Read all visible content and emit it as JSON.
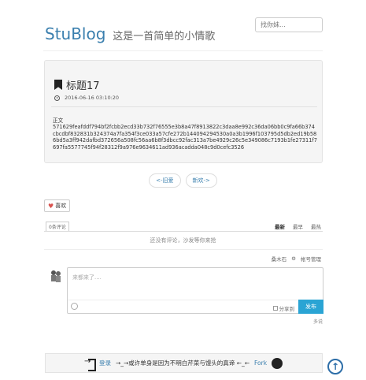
{
  "site": {
    "brand": "StuBlog",
    "tagline": "这是一首简单的小情歌"
  },
  "search": {
    "placeholder": "找你妹..."
  },
  "post": {
    "title": "标题17",
    "date": "2016-06-16 03:10:20",
    "body": "正文\n571629feafddf794bf2fcbb2ecd33b732f76555e3b8a47f8913822c3daa8e992c36da06bb0c9fa66b374cbcdbf832831b324374a7fa354f3ce033a57cfe272b144094294530a0a3b1996f103795d5db2ed19b586bd5a3ff942dafbd372656a508fc56aa6b8f3dbcc92fac313a7be4929c26c5e349086c7193b1fe27311f7697fa5577745f94f28312f9a976e9634611ad936acadda048c9d0cefc3526"
  },
  "pager": {
    "prev": "<-旧爱",
    "next": "新欢->"
  },
  "like": {
    "label": "喜欢"
  },
  "comments": {
    "count_label": "0条评论",
    "sort": [
      "最新",
      "最早",
      "最热"
    ],
    "empty": "还没有评论，沙发等你来抢",
    "user": "桑木石",
    "account_label": "帐号管理",
    "placeholder": "来都来了....",
    "share_label": "分享到",
    "publish_label": "发布",
    "provider": "多说"
  },
  "footer": {
    "login": "登录",
    "motto": "→_→或许单身是因为不明白芹菜与馒头的真谛 ←_←",
    "fork": "Fork"
  },
  "colors": {
    "accent": "#3a7fae",
    "publish": "#2aa4d4"
  },
  "icons": [
    "bookmark-icon",
    "clock-icon",
    "heart-icon",
    "gear-icon",
    "smiley-icon",
    "login-icon",
    "github-icon",
    "back-to-top-icon"
  ]
}
